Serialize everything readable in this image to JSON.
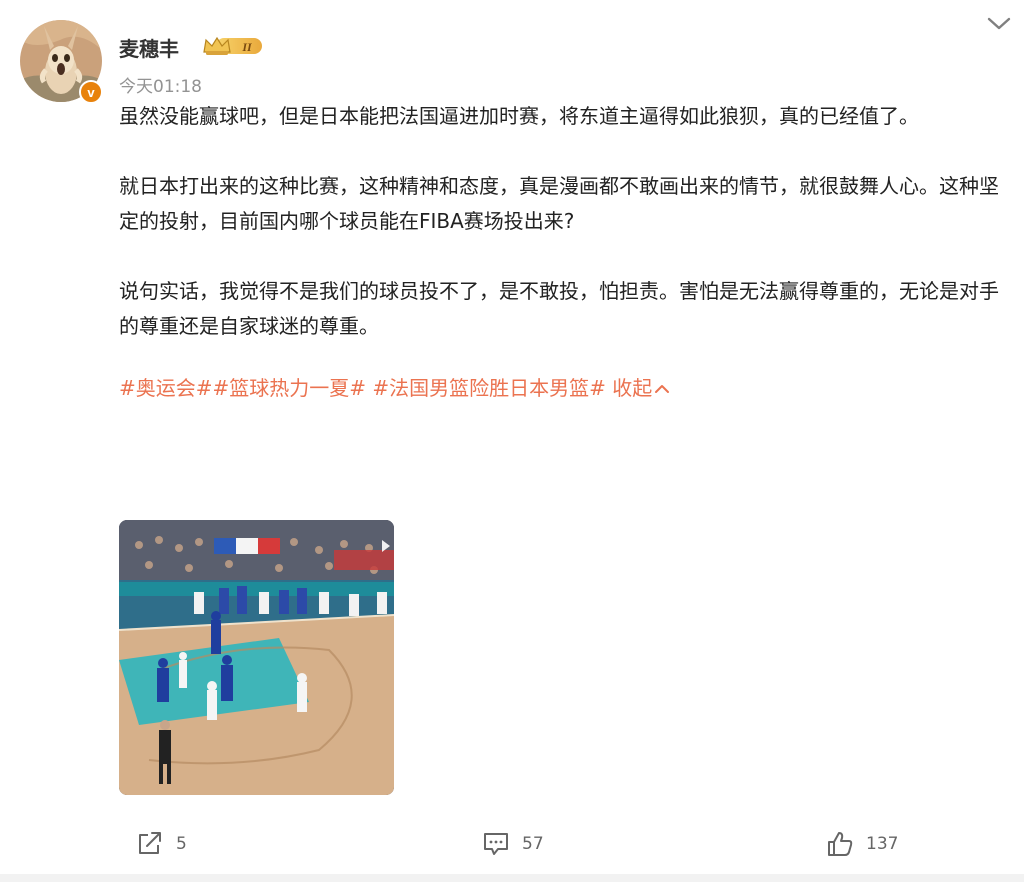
{
  "post": {
    "username": "麦穗丰",
    "vip_level": "II",
    "time": "今天01:18",
    "paragraphs": [
      "虽然没能赢球吧，但是日本能把法国逼进加时赛，将东道主逼得如此狼狈，真的已经值了。",
      "就日本打出来的这种比赛，这种精神和态度，真是漫画都不敢画出来的情节，就很鼓舞人心。这种坚定的投射，目前国内哪个球员能在FIBA赛场投出来?",
      "说句实话，我觉得不是我们的球员投不了，是不敢投，怕担责。害怕是无法赢得尊重的，无论是对手的尊重还是自家球迷的尊重。"
    ],
    "tags": [
      "#奥运会#",
      "#篮球热力一夏#",
      "#法国男篮险胜日本男篮#"
    ],
    "collapse_label": "收起",
    "verified_mark": "v"
  },
  "actions": {
    "repost_count": "5",
    "comment_count": "57",
    "like_count": "137"
  },
  "colors": {
    "tag": "#eb7350",
    "verified": "#e8820c",
    "meta": "#939393"
  },
  "icons": {
    "menu": "chevron-down-icon",
    "repost": "share-icon",
    "comment": "comment-icon",
    "like": "thumbs-up-icon"
  }
}
